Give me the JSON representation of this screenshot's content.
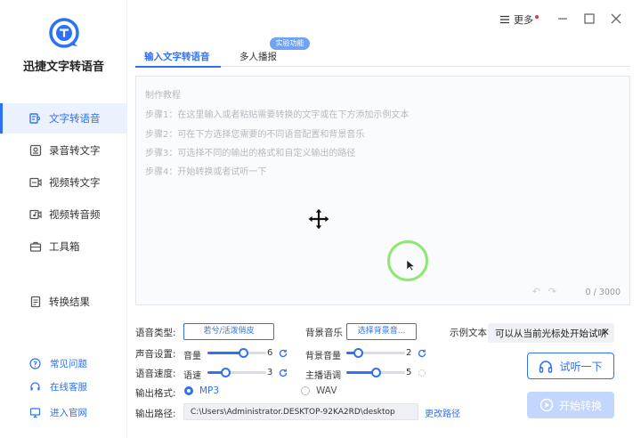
{
  "sidebar": {
    "app_title": "迅捷文字转语音",
    "nav": [
      {
        "label": "文字转语音",
        "icon": "text-to-speech-icon",
        "active": true
      },
      {
        "label": "录音转文字",
        "icon": "recording-icon",
        "active": false
      },
      {
        "label": "视频转文字",
        "icon": "video-text-icon",
        "active": false
      },
      {
        "label": "视频转音频",
        "icon": "video-audio-icon",
        "active": false
      },
      {
        "label": "工具箱",
        "icon": "toolbox-icon",
        "active": false
      },
      {
        "label": "转换结果",
        "icon": "result-icon",
        "active": false
      }
    ],
    "links": [
      {
        "label": "常见问题",
        "icon": "help-icon"
      },
      {
        "label": "在线客服",
        "icon": "headset-icon"
      },
      {
        "label": "进入官网",
        "icon": "monitor-icon"
      }
    ]
  },
  "titlebar": {
    "more_label": "更多"
  },
  "tabs": [
    {
      "label": "输入文字转语音",
      "active": true
    },
    {
      "label": "多人播报",
      "active": false
    }
  ],
  "lab_badge": "实验功能",
  "editor": {
    "hints": [
      "制作教程",
      "步骤1：在这里输入或者粘贴需要转换的文字或在下方添加示例文本",
      "步骤2：可在下方选择您需要的不同语音配置和背景音乐",
      "步骤3：可选择不同的输出的格式和自定义输出的路径",
      "步骤4：开始转换或者试听一下"
    ],
    "char_count": "0 / 3000"
  },
  "settings": {
    "voice_type_label": "语音类型:",
    "voice_type_value": "若兮/活泼俏皮",
    "bgm_label": "背景音乐",
    "bgm_button": "选择背景音...",
    "sample_label": "示例文本",
    "sample_text": "可以从当前光标处开始试听",
    "sound_label": "声音设置:",
    "speed_label": "语音速度:",
    "volume_name": "音量",
    "volume_value": "6",
    "volume_fraction": 0.6,
    "speed_name": "语速",
    "speed_value": "3",
    "speed_fraction": 0.3,
    "bg_volume_name": "背景音量",
    "bg_volume_value": "2",
    "bg_volume_fraction": 0.2,
    "pitch_name": "主播语调",
    "pitch_value": "5",
    "pitch_fraction": 0.5,
    "format_label": "输出格式:",
    "format_options": [
      "MP3",
      "WAV"
    ],
    "format_selected": "MP3",
    "path_label": "输出路径:",
    "path_value": "C:\\Users\\Administrator.DESKTOP-92KA2RD\\desktop",
    "change_path": "更改路径"
  },
  "actions": {
    "listen": "试听一下",
    "convert": "开始转换"
  },
  "colors": {
    "accent": "#2d71f6",
    "active_bg": "#ecf2fd",
    "disabled_btn": "#c3d6fc",
    "click_ring": "#8ce870"
  }
}
